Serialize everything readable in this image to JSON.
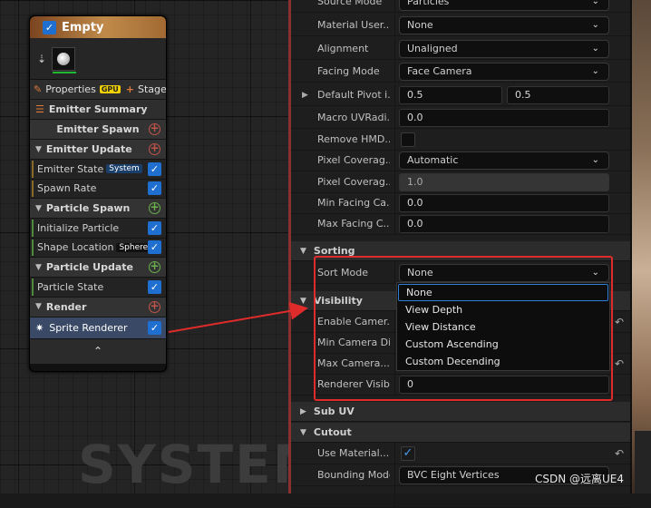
{
  "graph": {
    "watermark": "SYSTEM"
  },
  "emitter_node": {
    "title": "Empty",
    "properties_label": "Properties",
    "gpu_badge": "GPU",
    "stage_label": "Stage",
    "sections": {
      "summary": "Emitter Summary",
      "emitter_spawn": "Emitter Spawn",
      "emitter_update": "Emitter Update",
      "particle_spawn": "Particle Spawn",
      "particle_update": "Particle Update",
      "render": "Render"
    },
    "modules": {
      "emitter_state": "Emitter State",
      "emitter_state_tag": "System",
      "spawn_rate": "Spawn Rate",
      "initialize_particle": "Initialize Particle",
      "shape_location": "Shape Location",
      "shape_location_tag": "Sphere",
      "particle_state": "Particle State",
      "sprite_renderer": "Sprite Renderer"
    }
  },
  "details": {
    "rows": {
      "source_mode": {
        "label": "Source Mode",
        "value": "Particles"
      },
      "material_user": {
        "label": "Material User...",
        "value": "None"
      },
      "alignment": {
        "label": "Alignment",
        "value": "Unaligned"
      },
      "facing_mode": {
        "label": "Facing Mode",
        "value": "Face Camera"
      },
      "default_pivot": {
        "label": "Default Pivot i...",
        "x": "0.5",
        "y": "0.5"
      },
      "macro_uv": {
        "label": "Macro UVRadi...",
        "value": "0.0"
      },
      "remove_hmd": {
        "label": "Remove HMD..."
      },
      "pixel_coverage_mode": {
        "label": "Pixel Coverag...",
        "value": "Automatic"
      },
      "pixel_coverage_blend": {
        "label": "Pixel Coverag...",
        "value": "1.0"
      },
      "min_facing": {
        "label": "Min Facing Ca...",
        "value": "0.0"
      },
      "max_facing": {
        "label": "Max Facing C...",
        "value": "0.0"
      },
      "sort_mode": {
        "label": "Sort Mode",
        "value": "None"
      },
      "enable_camera": {
        "label": "Enable Camer..."
      },
      "min_camera": {
        "label": "Min Camera Di..."
      },
      "max_camera": {
        "label": "Max Camera..."
      },
      "renderer_visibility": {
        "label": "Renderer Visib...",
        "value": "0"
      },
      "use_material": {
        "label": "Use Material..."
      },
      "bounding_mode": {
        "label": "Bounding Mode",
        "value": "BVC Eight Vertices"
      }
    },
    "categories": {
      "sorting": "Sorting",
      "visibility": "Visibility",
      "sub_uv": "Sub UV",
      "cutout": "Cutout"
    }
  },
  "sort_menu": {
    "options": [
      "None",
      "View Depth",
      "View Distance",
      "Custom Ascending",
      "Custom Decending"
    ],
    "selected": "None"
  },
  "footer_watermark": "CSDN @远离UE4",
  "colors": {
    "highlight_box": "#e02b2b",
    "accent_blue": "#1f6fd1"
  }
}
